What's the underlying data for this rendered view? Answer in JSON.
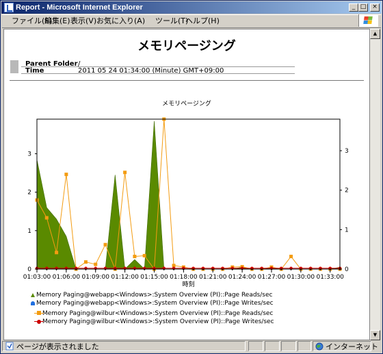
{
  "window": {
    "title": "Report - Microsoft Internet Explorer",
    "controls": {
      "minimize": "_",
      "maximize": "□",
      "close": "×"
    }
  },
  "menu": {
    "items": [
      "ファイル(F)",
      "編集(E)",
      "表示(V)",
      "お気に入り(A)",
      "ツール(T)",
      "ヘルプ(H)"
    ]
  },
  "report": {
    "title": "メモリページング",
    "parent_folder_label": "Parent Folder",
    "parent_folder_value": "/",
    "time_label": "Time",
    "time_value": "2011 05 24 01:34:00  (Minute)  GMT+09:00"
  },
  "status": {
    "text": "ページが表示されました",
    "zone": "インターネット"
  },
  "icons": [
    "ie-page-icon",
    "windows-logo-icon",
    "scroll-up-icon",
    "scroll-down-icon",
    "zone-globe-icon"
  ],
  "colors": {
    "webapp_reads": "#5a8a00",
    "webapp_writes": "#1f6fe0",
    "wilbur_reads": "#f39c12",
    "wilbur_writes": "#cc0000"
  },
  "chart_data": {
    "type": "line",
    "title": "メモリページング",
    "xlabel": "時刻",
    "x": [
      "01:03:00",
      "01:04:00",
      "01:05:00",
      "01:06:00",
      "01:07:00",
      "01:08:00",
      "01:09:00",
      "01:10:00",
      "01:11:00",
      "01:12:00",
      "01:13:00",
      "01:14:00",
      "01:15:00",
      "01:16:00",
      "01:17:00",
      "01:18:00",
      "01:19:00",
      "01:20:00",
      "01:21:00",
      "01:22:00",
      "01:23:00",
      "01:24:00",
      "01:25:00",
      "01:26:00",
      "01:27:00",
      "01:28:00",
      "01:29:00",
      "01:30:00",
      "01:31:00",
      "01:32:00",
      "01:33:00",
      "01:34:00"
    ],
    "x_tick_labels": [
      "01:03:00",
      "01:06:00",
      "01:09:00",
      "01:12:00",
      "01:15:00",
      "01:18:00",
      "01:21:00",
      "01:24:00",
      "01:27:00",
      "01:30:00",
      "01:33:00"
    ],
    "y_left_ticks": [
      "0",
      "1",
      "2",
      "3"
    ],
    "y_right_ticks": [
      "0",
      "1",
      "2",
      "3"
    ],
    "ylim_left": [
      0,
      3.9
    ],
    "ylim_right": [
      0,
      3.8
    ],
    "series": [
      {
        "name": "Memory Paging@webapp<Windows>:System Overview (PI)::Page Reads/sec",
        "type": "area",
        "axis": "left",
        "values": [
          2.85,
          1.6,
          1.3,
          0.85,
          0,
          0,
          0,
          0,
          2.45,
          0,
          0.25,
          0,
          3.85,
          0,
          0,
          0,
          0,
          0,
          0,
          0,
          0,
          0.05,
          0,
          0,
          0.05,
          0,
          0,
          0,
          0,
          0,
          0,
          0.05
        ]
      },
      {
        "name": "Memory Paging@webapp<Windows>:System Overview (PI)::Page Writes/sec",
        "type": "area",
        "axis": "left",
        "values": [
          0,
          0,
          0,
          0,
          0,
          0,
          0,
          0,
          0,
          0,
          0,
          0,
          0,
          0,
          0,
          0,
          0,
          0,
          0,
          0,
          0,
          0,
          0,
          0,
          0,
          0,
          0,
          0,
          0,
          0,
          0,
          0
        ]
      },
      {
        "name": "Memory Paging@wilbur<Windows>:System Overview (PI)::Page Reads/sec",
        "type": "line",
        "axis": "right",
        "values": [
          1.75,
          1.3,
          0.42,
          2.4,
          0,
          0.18,
          0.12,
          0.62,
          0,
          2.45,
          0.32,
          0.34,
          0,
          3.8,
          0.09,
          0.05,
          0,
          0,
          0,
          0,
          0.05,
          0.06,
          0,
          0,
          0.05,
          0,
          0.32,
          0,
          0,
          0,
          0,
          0
        ]
      },
      {
        "name": "Memory Paging@wilbur<Windows>:System Overview (PI)::Page Writes/sec",
        "type": "line",
        "axis": "right",
        "values": [
          0.02,
          0.02,
          0.02,
          0.02,
          0.02,
          0.02,
          0.02,
          0.02,
          0.02,
          0.02,
          0.02,
          0.02,
          0.02,
          0.02,
          0.02,
          0.02,
          0.02,
          0.02,
          0.02,
          0.02,
          0.02,
          0.02,
          0.02,
          0.02,
          0.02,
          0.02,
          0.02,
          0.02,
          0.02,
          0.02,
          0.02,
          0.02
        ]
      }
    ]
  }
}
